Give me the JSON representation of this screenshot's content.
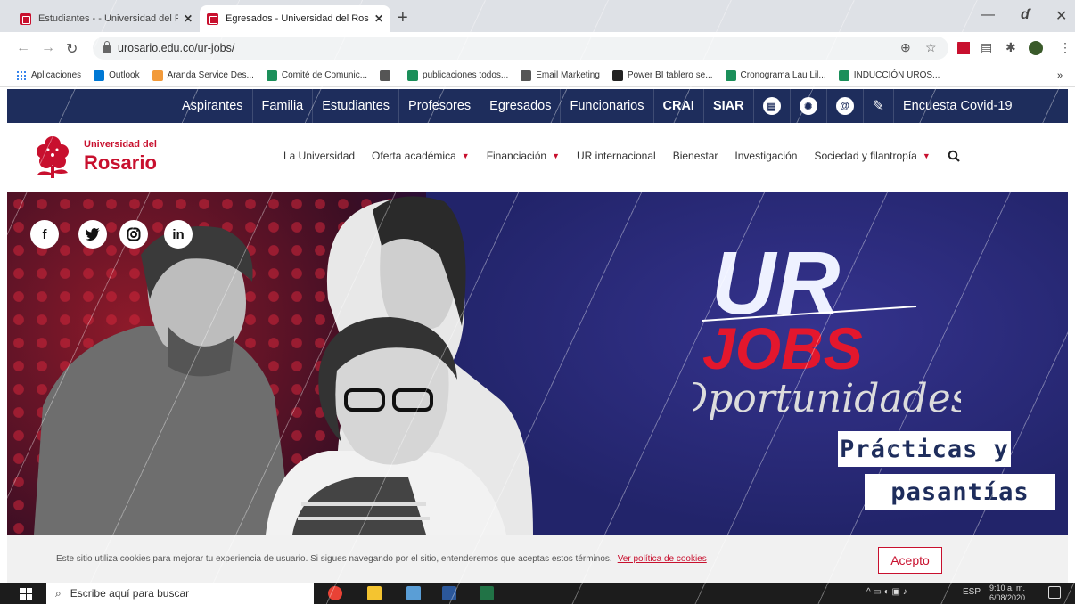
{
  "browser": {
    "tabs": [
      {
        "title": "Estudiantes - - Universidad del R",
        "active": false
      },
      {
        "title": "Egresados - Universidad del Rosa",
        "active": true
      }
    ],
    "url": "urosario.edu.co/ur-jobs/",
    "bookmarks": [
      {
        "label": "Aplicaciones",
        "color": "#f4b400"
      },
      {
        "label": "Outlook",
        "color": "#0078d4"
      },
      {
        "label": "Aranda Service Des...",
        "color": "#f29a3a"
      },
      {
        "label": "Comité de Comunic...",
        "color": "#1b8f5a"
      },
      {
        "label": "",
        "color": "#555555"
      },
      {
        "label": "publicaciones todos...",
        "color": "#1b8f5a"
      },
      {
        "label": "Email Marketing",
        "color": "#555555"
      },
      {
        "label": "Power BI tablero se...",
        "color": "#222222"
      },
      {
        "label": "Cronograma Lau Lil...",
        "color": "#1b8f5a"
      },
      {
        "label": "INDUCCIÓN UROS...",
        "color": "#1b8f5a"
      }
    ]
  },
  "site": {
    "top_nav": [
      {
        "label": "Aspirantes",
        "bold": false
      },
      {
        "label": "Familia",
        "bold": false
      },
      {
        "label": "Estudiantes",
        "bold": false
      },
      {
        "label": "Profesores",
        "bold": false
      },
      {
        "label": "Egresados",
        "bold": false
      },
      {
        "label": "Funcionarios",
        "bold": false
      },
      {
        "label": "CRAI",
        "bold": true
      },
      {
        "label": "SIAR",
        "bold": true
      }
    ],
    "survey_link": "Encuesta Covid-19",
    "logo": {
      "line1": "Universidad del",
      "line2": "Rosario"
    },
    "main_nav": [
      {
        "label": "La Universidad",
        "caret": false
      },
      {
        "label": "Oferta académica",
        "caret": true
      },
      {
        "label": "Financiación",
        "caret": true
      },
      {
        "label": "UR internacional",
        "caret": false
      },
      {
        "label": "Bienestar",
        "caret": false
      },
      {
        "label": "Investigación",
        "caret": false
      },
      {
        "label": "Sociedad y filantropía",
        "caret": true
      }
    ],
    "hero": {
      "social": [
        "f",
        "t",
        "ig",
        "in"
      ],
      "brand_top": "UR",
      "brand_mid": "JOBS",
      "brand_script": "Oportunidades",
      "tag1": "Prácticas y",
      "tag2": "pasantías"
    },
    "cookie": {
      "text": "Este sitio utiliza cookies para mejorar tu experiencia de usuario. Si sigues navegando por el sitio, entenderemos que aceptas estos términos.",
      "link": "Ver política de cookies",
      "button": "Acepto"
    }
  },
  "taskbar": {
    "search_placeholder": "Escribe aquí para buscar",
    "lang": "ESP",
    "time": "9:10 a. m.",
    "date": "6/08/2020"
  },
  "colors": {
    "brand_red": "#c8102e",
    "navy": "#1e2d5c"
  }
}
